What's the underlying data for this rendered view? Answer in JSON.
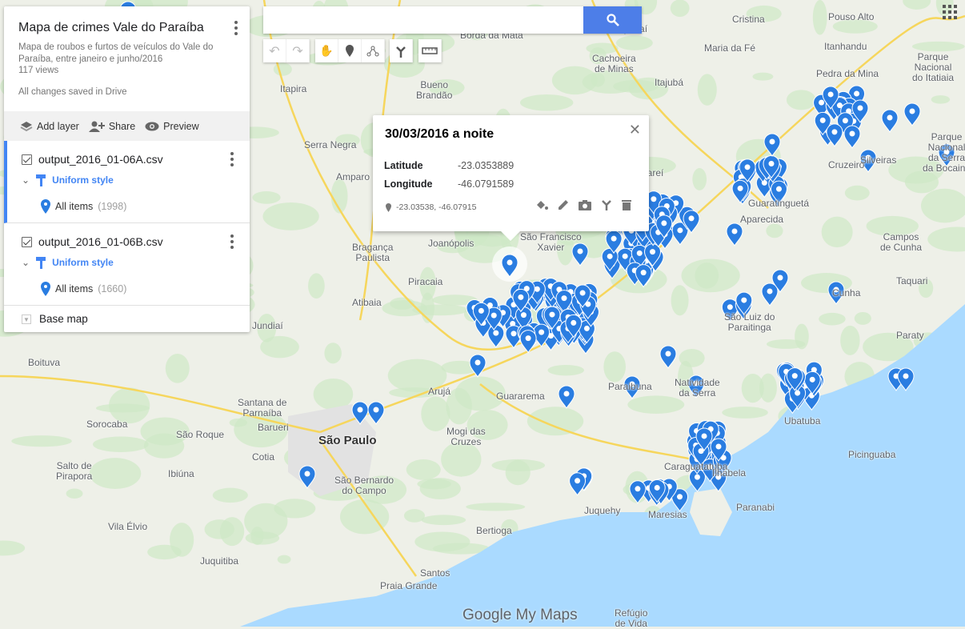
{
  "map": {
    "title": "Mapa de crimes Vale do Paraíba",
    "description": "Mapa de roubos e furtos de veículos do Vale do Paraíba, entre janeiro e junho/2016",
    "views": "117 views",
    "save_status": "All changes saved in Drive"
  },
  "actions": {
    "add_layer": "Add layer",
    "share": "Share",
    "preview": "Preview"
  },
  "layers": [
    {
      "name": "output_2016_01-06A.csv",
      "style": "Uniform style",
      "items_label": "All items",
      "count": "(1998)",
      "checked": true
    },
    {
      "name": "output_2016_01-06B.csv",
      "style": "Uniform style",
      "items_label": "All items",
      "count": "(1660)",
      "checked": true
    }
  ],
  "base_map": "Base map",
  "search": {
    "value": "",
    "placeholder": ""
  },
  "toolbar": [
    "undo-icon",
    "redo-icon",
    "hand-icon",
    "marker-icon",
    "line-icon",
    "directions-icon",
    "ruler-icon"
  ],
  "popup": {
    "title": "30/03/2016 a noite",
    "fields": [
      {
        "label": "Latitude",
        "value": "-23.0353889"
      },
      {
        "label": "Longitude",
        "value": "-46.0791589"
      }
    ],
    "coords": "-23.03538, -46.07915"
  },
  "footer_logo": "Google My Maps",
  "colors": {
    "pin": "#2a7de1",
    "accent": "#4285f4",
    "ocean": "#aadaff",
    "land": "#eef0e8",
    "forest": "#cfe8c6"
  },
  "cities": [
    "São Paulo",
    "São Bernardo\ndo Campo",
    "Mogi das\nCruzes",
    "Guararema",
    "Arujá",
    "Atibaia",
    "Bragança\nPaulista",
    "Piracaia",
    "Joanópolis",
    "Jundiaí",
    "Barueri",
    "Santana de\nParnaíba",
    "Sorocaba",
    "São Roque",
    "Cotia",
    "Salto de\nPirapora",
    "Ibiúna",
    "Vila Élvio",
    "Juquitiba",
    "Santos",
    "Praia Grande",
    "Bertioga",
    "Paraibuna",
    "Natividade\nda Serra",
    "São Luiz do\nParaitinga",
    "Caraguatatuba",
    "Ubatuba",
    "Paraty",
    "Picinguaba",
    "Cunha",
    "Taquari",
    "Campos\nde Cunha",
    "Guaratinguetá",
    "Aparecida",
    "Cruzeiro",
    "Silveiras",
    "Pedra da Mina",
    "Parque\nNacional\ndo Itatiaia",
    "Parque\nNacional\nda Serra\nda Bocaina",
    "Itajubá",
    "Maria da Fé",
    "Cristina",
    "Pouso Alto",
    "Itanhandu",
    "Cachoeira\nde Minas",
    "Bueno\nBrandão",
    "Itapira",
    "Serra Negra",
    "Amparo",
    "Borda da Mata",
    "Boituva",
    "Paranabi",
    "Refúgio\nde Vida",
    "Jacareí",
    "São Francisco\nXavier",
    "Ilhabela",
    "Juquehy",
    "Maresias",
    "Sapucaí"
  ]
}
